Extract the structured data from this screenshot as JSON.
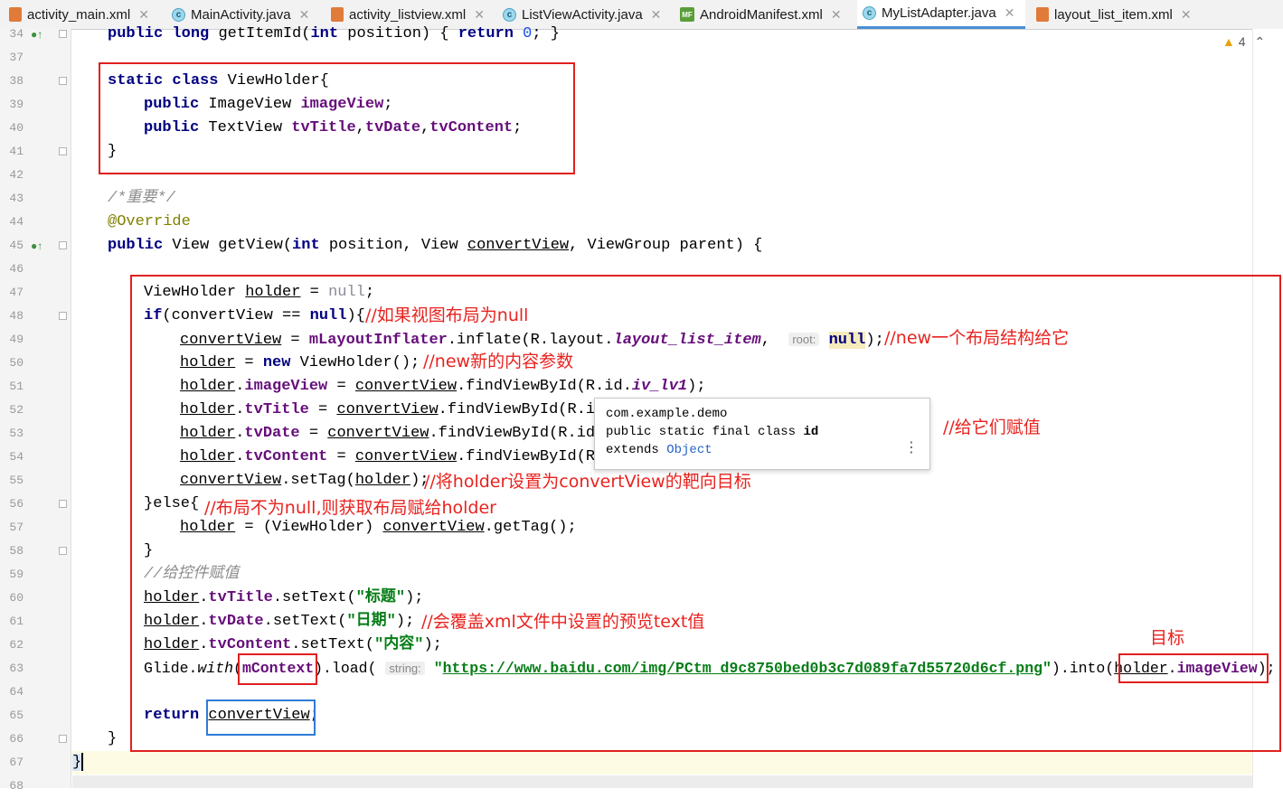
{
  "tabs": [
    {
      "label": "activity_main.xml",
      "type": "xml",
      "active": false
    },
    {
      "label": "MainActivity.java",
      "type": "java",
      "active": false
    },
    {
      "label": "activity_listview.xml",
      "type": "xml",
      "active": false
    },
    {
      "label": "ListViewActivity.java",
      "type": "java",
      "active": false
    },
    {
      "label": "AndroidManifest.xml",
      "type": "mf",
      "active": false
    },
    {
      "label": "MyListAdapter.java",
      "type": "java",
      "active": true
    },
    {
      "label": "layout_list_item.xml",
      "type": "xml",
      "active": false
    }
  ],
  "warnings_count": "4",
  "line_numbers": [
    "34",
    "37",
    "38",
    "39",
    "40",
    "41",
    "42",
    "43",
    "44",
    "45",
    "46",
    "47",
    "48",
    "49",
    "50",
    "51",
    "52",
    "53",
    "54",
    "55",
    "56",
    "57",
    "58",
    "59",
    "60",
    "61",
    "62",
    "63",
    "64",
    "65",
    "66",
    "67",
    "68"
  ],
  "code": {
    "l34": {
      "a": "public",
      "b": "long",
      "c": "getItemId(",
      "d": "int",
      "e": "position)",
      "f": "{",
      "g": "return",
      "h": "0",
      "i": ";",
      "j": "}"
    },
    "l38": {
      "a": "static",
      "b": "class",
      "c": "ViewHolder{"
    },
    "l39": {
      "a": "public",
      "b": "ImageView",
      "c": "imageView",
      "d": ";"
    },
    "l40": {
      "a": "public",
      "b": "TextView",
      "c": "tvTitle",
      "d": ",",
      "e": "tvDate",
      "f": ",",
      "g": "tvContent",
      "h": ";"
    },
    "l41": {
      "a": "}"
    },
    "l43": {
      "a": "/*重要*/"
    },
    "l44": {
      "a": "@Override"
    },
    "l45": {
      "a": "public",
      "b": "View getView(",
      "c": "int",
      "d": "position, View",
      "e": "convertView",
      "f": ", ViewGroup parent) {"
    },
    "l47": {
      "a": "ViewHolder",
      "b": "holder",
      "c": "=",
      "d": "null",
      "e": ";"
    },
    "l48": {
      "a": "if",
      "b": "(convertView ==",
      "c": "null",
      "d": "){"
    },
    "l49": {
      "a": "convertView",
      "b": "=",
      "c": "mLayoutInflater",
      "d": ".inflate(R.layout.",
      "e": "layout_list_item",
      "f": ",",
      "hint": "root:",
      "g": "null",
      "h": ");"
    },
    "l50": {
      "a": "holder",
      "b": "=",
      "c": "new",
      "d": "ViewHolder();"
    },
    "l51": {
      "a": "holder",
      "b": ".",
      "c": "imageView",
      "d": "=",
      "e": "convertView",
      "f": ".findViewById(R.id.",
      "g": "iv_lv1",
      "h": ");"
    },
    "l52": {
      "a": "holder",
      "b": ".",
      "c": "tvTitle",
      "d": "=",
      "e": "convertView",
      "f": ".findViewById(R.id"
    },
    "l53": {
      "a": "holder",
      "b": ".",
      "c": "tvDate",
      "d": "=",
      "e": "convertView",
      "f": ".findViewById(R.id."
    },
    "l54": {
      "a": "holder",
      "b": ".",
      "c": "tvContent",
      "d": "=",
      "e": "convertView",
      "f": ".findViewById(R."
    },
    "l55": {
      "a": "convertView",
      "b": ".setTag(",
      "c": "holder",
      "d": ");"
    },
    "l56": {
      "a": "}else{"
    },
    "l57": {
      "a": "holder",
      "b": "= (ViewHolder)",
      "c": "convertView",
      "d": ".getTag();"
    },
    "l58": {
      "a": "}"
    },
    "l59": {
      "a": "//给控件赋值"
    },
    "l60": {
      "a": "holder",
      "b": ".",
      "c": "tvTitle",
      "d": ".setText(",
      "e": "\"标题\"",
      "f": ");"
    },
    "l61": {
      "a": "holder",
      "b": ".",
      "c": "tvDate",
      "d": ".setText(",
      "e": "\"日期\"",
      "f": ");"
    },
    "l62": {
      "a": "holder",
      "b": ".",
      "c": "tvContent",
      "d": ".setText(",
      "e": "\"内容\"",
      "f": ");"
    },
    "l63": {
      "a": "Glide.",
      "b": "with",
      "c": "(",
      "d": "mContext",
      "e": ").load(",
      "hint": "string:",
      "f": "\"",
      "g": "https://www.baidu.com/img/PCtm_d9c8750bed0b3c7d089fa7d55720d6cf.png",
      "h": "\"",
      "i": ").into(",
      "j": "holder",
      "k": ".",
      "l": "imageView",
      "m": ");"
    },
    "l65": {
      "a": "return",
      "b": "convertView",
      "c": ";"
    },
    "l66": {
      "a": "}"
    },
    "l67": {
      "a": "}"
    }
  },
  "notes": {
    "n48": "//如果视图布局为null",
    "n49": "//new一个布局结构给它",
    "n50": "//new新的内容参数",
    "n53": "//给它们赋值",
    "n55": "//将holder设置为convertView的靶向目标",
    "n56": "//布局不为null,则获取布局赋给holder",
    "n61": "//会覆盖xml文件中设置的预览text值",
    "n62": "目标"
  },
  "popup": {
    "package": "com.example.demo",
    "decl_prefix": "public static final class",
    "decl_name": "id",
    "extends_kw": "extends",
    "extends_type": "Object",
    "menu": "⋮"
  },
  "colors": {
    "annotation_red": "#e02020",
    "annotation_blue": "#2f7bd6",
    "tab_active": "#4a8fd6"
  }
}
